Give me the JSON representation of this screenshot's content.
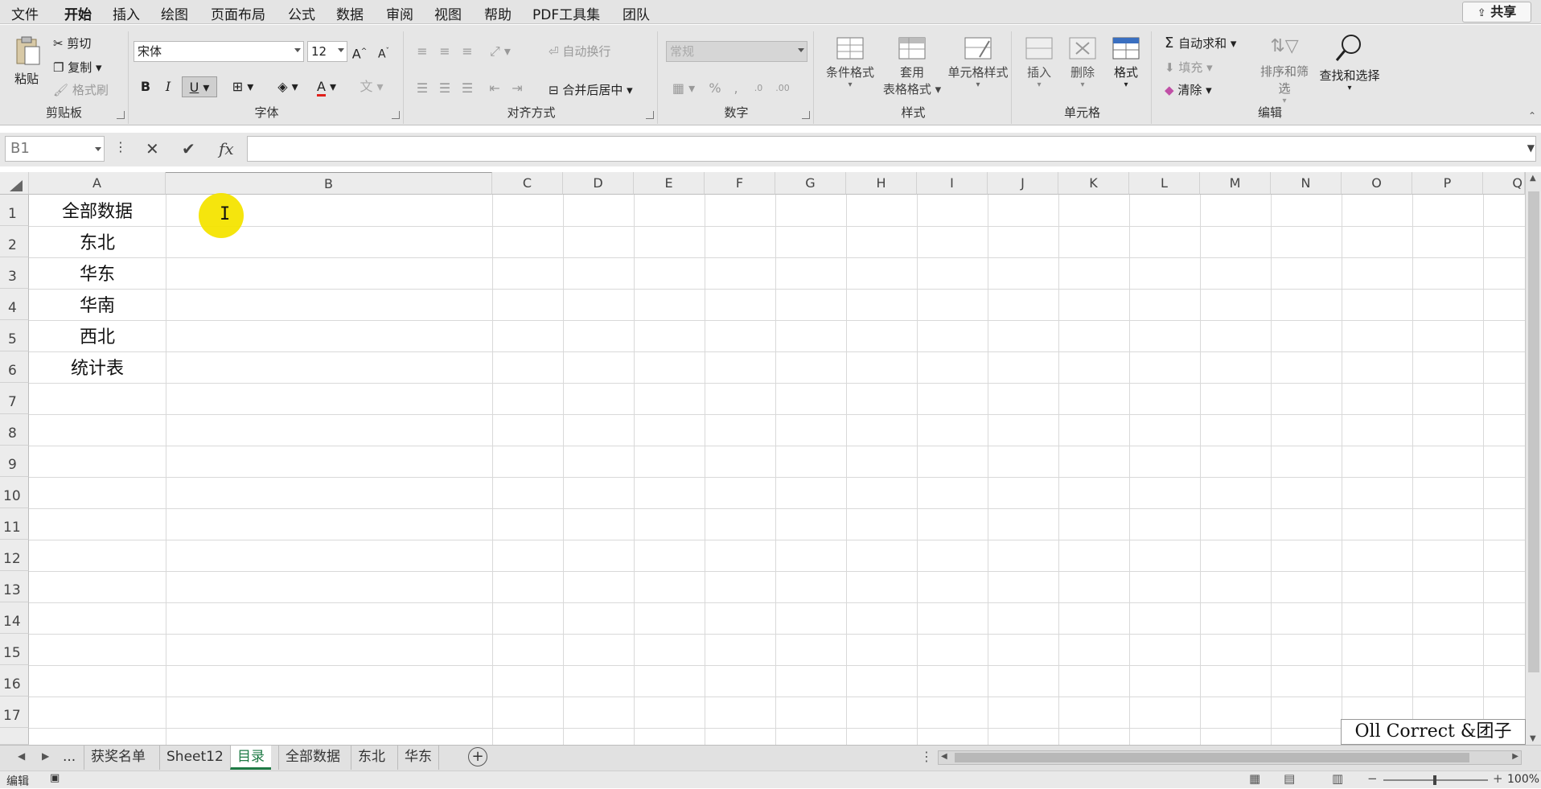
{
  "menu": {
    "items": [
      "文件",
      "开始",
      "插入",
      "绘图",
      "页面布局",
      "公式",
      "数据",
      "审阅",
      "视图",
      "帮助",
      "PDF工具集",
      "团队"
    ],
    "active": "开始",
    "share_label": "共享"
  },
  "ribbon": {
    "clipboard": {
      "paste": "粘贴",
      "cut": "剪切",
      "copy": "复制",
      "format_painter": "格式刷",
      "label": "剪贴板"
    },
    "font": {
      "name": "宋体",
      "size": "12",
      "bold": "B",
      "italic": "I",
      "underline": "U",
      "font_color_glyph": "A",
      "label": "字体"
    },
    "alignment": {
      "wrap": "自动换行",
      "merge": "合并后居中",
      "label": "对齐方式"
    },
    "number": {
      "format": "常规",
      "label": "数字"
    },
    "styles": {
      "cond_format": "条件格式",
      "table_format_1": "套用",
      "table_format_2": "表格格式",
      "cell_styles": "单元格样式",
      "label": "样式"
    },
    "cells": {
      "insert": "插入",
      "delete": "删除",
      "format": "格式",
      "label": "单元格"
    },
    "editing": {
      "autosum": "自动求和",
      "fill": "填充",
      "clear": "清除",
      "sort_filter": "排序和筛选",
      "find_select": "查找和选择",
      "label": "编辑"
    }
  },
  "formula_bar": {
    "name_box": "B1",
    "cancel": "✕",
    "enter": "✔",
    "fx": "fx",
    "value": ""
  },
  "columns": [
    "A",
    "B",
    "C",
    "D",
    "E",
    "F",
    "G",
    "H",
    "I",
    "J",
    "K",
    "L",
    "M",
    "N",
    "O",
    "P",
    "Q"
  ],
  "rows": [
    "1",
    "2",
    "3",
    "4",
    "5",
    "6",
    "7",
    "8",
    "9",
    "10",
    "11",
    "12",
    "13",
    "14",
    "15",
    "16",
    "17"
  ],
  "cells_col_a": [
    "全部数据",
    "东北",
    "华东",
    "华南",
    "西北",
    "统计表"
  ],
  "sheet_tabs": [
    "获奖名单",
    "Sheet12",
    "目录",
    "全部数据",
    "东北",
    "华东"
  ],
  "active_sheet": "目录",
  "tab_ellipsis": "...",
  "status": {
    "mode": "编辑",
    "zoom": "100%"
  },
  "watermark": "Oll Correct &团子",
  "colors": {
    "accent_green": "#1e7a45",
    "highlight_yellow": "#f4e400",
    "font_color_red": "#e0201a"
  }
}
